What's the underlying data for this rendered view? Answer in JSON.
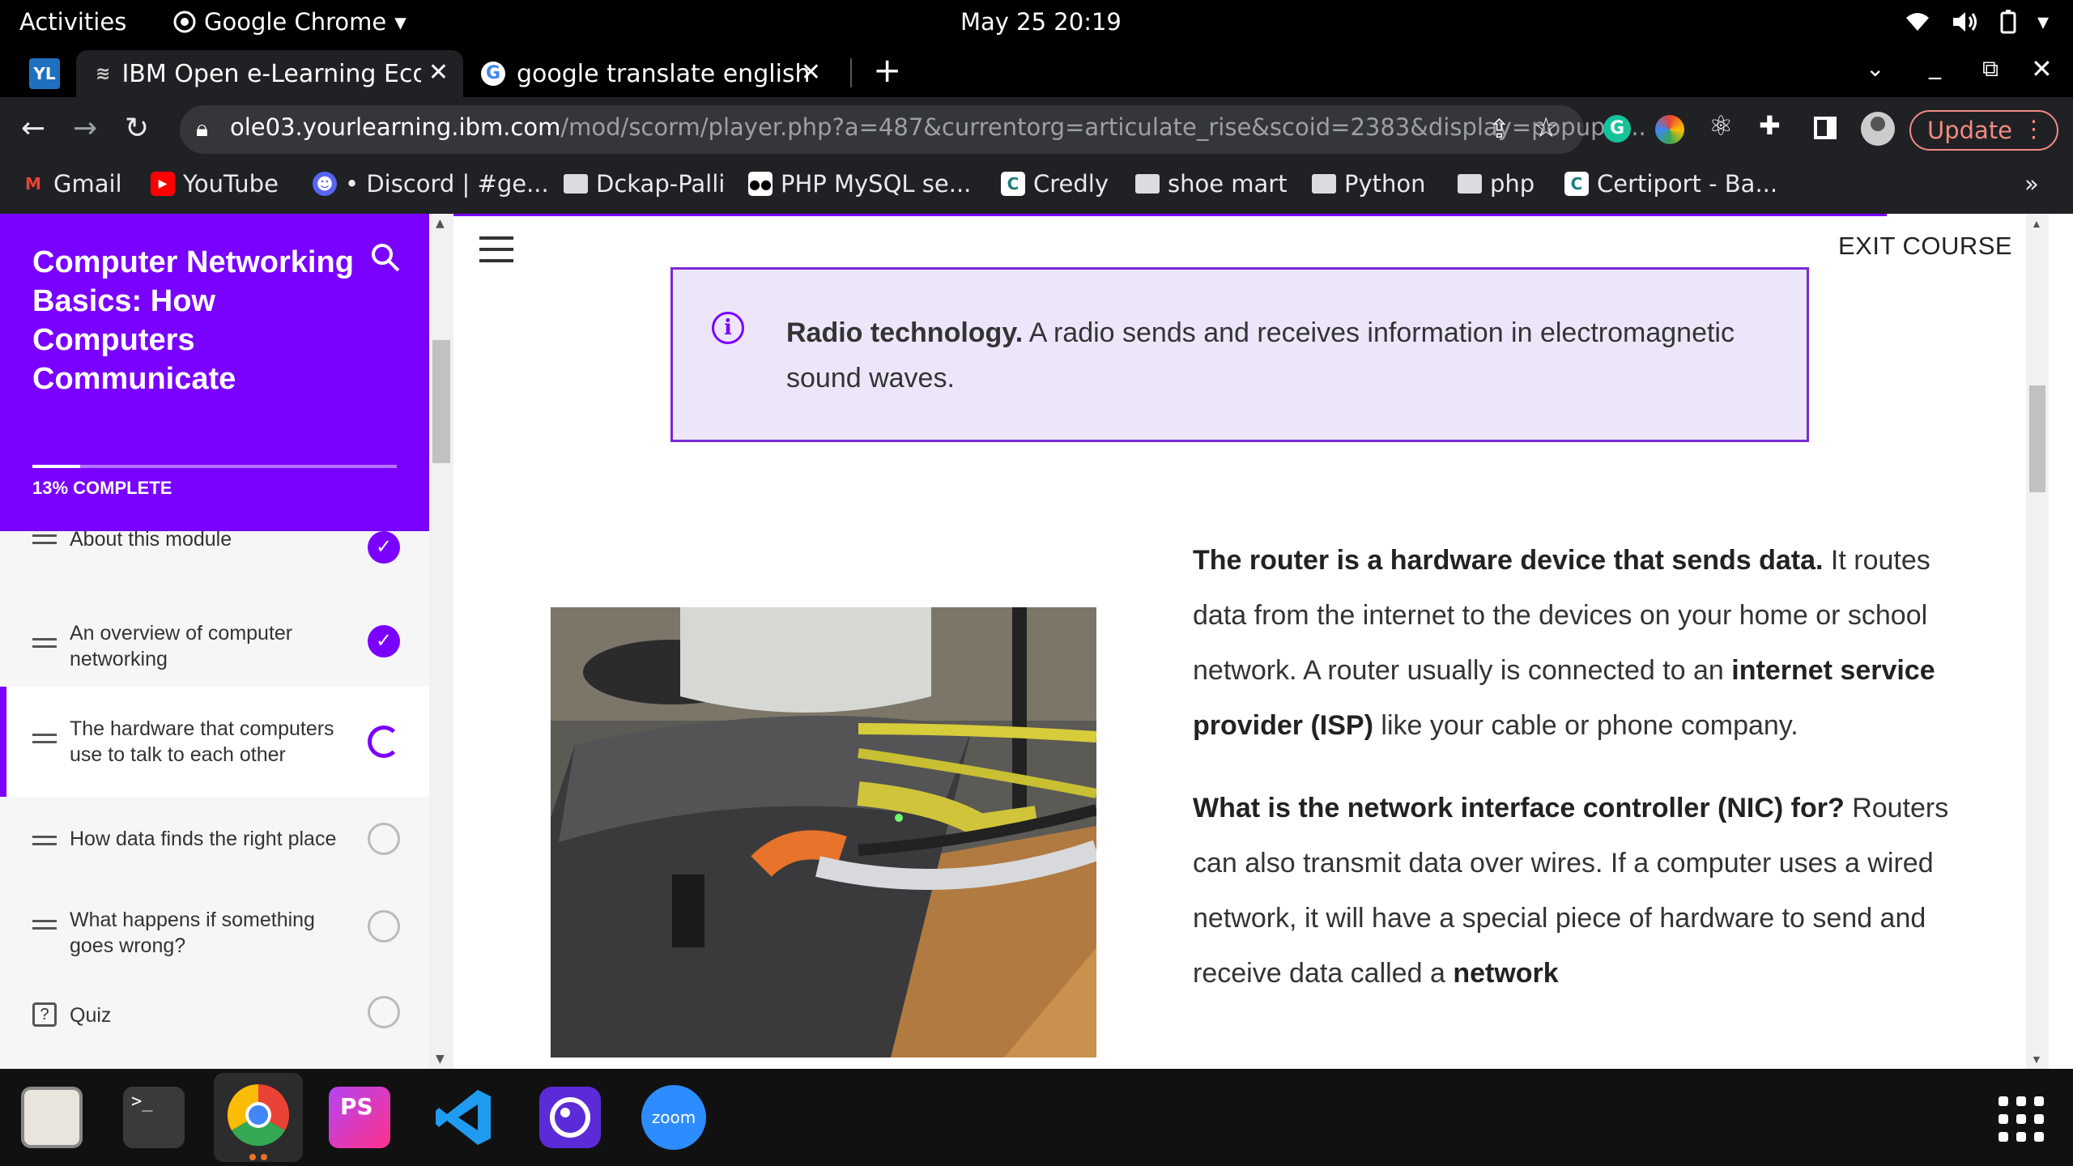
{
  "system": {
    "activities": "Activities",
    "app_name": "Google Chrome",
    "clock": "May 25  20:19"
  },
  "tabs": [
    {
      "title": "IBM Open e-Learning Eco",
      "active": true
    },
    {
      "title": "google translate english t",
      "active": false
    }
  ],
  "toolbar": {
    "url_host": "ole03.yourlearning.ibm.com",
    "url_path": "/mod/scorm/player.php?a=487&currentorg=articulate_rise&scoid=2383&display=popup&...",
    "update_label": "Update"
  },
  "bookmarks": [
    {
      "label": "Gmail",
      "icon": "gmail-icon"
    },
    {
      "label": "YouTube",
      "icon": "youtube-icon"
    },
    {
      "label": "• Discord | #ge...",
      "icon": "discord-icon"
    },
    {
      "label": "Dckap-Palli",
      "icon": "folder-icon"
    },
    {
      "label": "PHP MySQL se...",
      "icon": "medium-icon"
    },
    {
      "label": "Credly",
      "icon": "credly-icon"
    },
    {
      "label": "shoe mart",
      "icon": "folder-icon"
    },
    {
      "label": "Python",
      "icon": "folder-icon"
    },
    {
      "label": "php",
      "icon": "folder-icon"
    },
    {
      "label": "Certiport - Ba...",
      "icon": "certiport-icon"
    }
  ],
  "course": {
    "title": "Computer Networking Basics: How Computers Communicate",
    "progress_label": "13% COMPLETE",
    "progress_fraction": 0.13,
    "lessons": [
      {
        "label": "About this module",
        "status": "done"
      },
      {
        "label": "An overview of computer networking",
        "status": "done"
      },
      {
        "label": "The hardware that computers use to talk to each other",
        "status": "in-progress"
      },
      {
        "label": "How data finds the right place",
        "status": "todo"
      },
      {
        "label": "What happens if something goes wrong?",
        "status": "todo"
      },
      {
        "label": "Quiz",
        "status": "todo"
      }
    ]
  },
  "content": {
    "exit_label": "EXIT COURSE",
    "callout_bold": "Radio technology.",
    "callout_text": " A radio sends and receives information in electromagnetic sound waves.",
    "p1_bold": "The router is a hardware device that sends data.",
    "p1_a": " It routes data from the internet to the devices on your home or school network. A router usually is connected to an ",
    "p1_bold2": "internet service provider (ISP)",
    "p1_b": " like your cable or phone company.",
    "p2_bold": "What is the network interface controller (NIC) for?",
    "p2_a": " Routers can also transmit data over wires. If a computer uses a wired network, it will have a special piece of hardware to send and receive data called a ",
    "p2_bold2": "network"
  }
}
